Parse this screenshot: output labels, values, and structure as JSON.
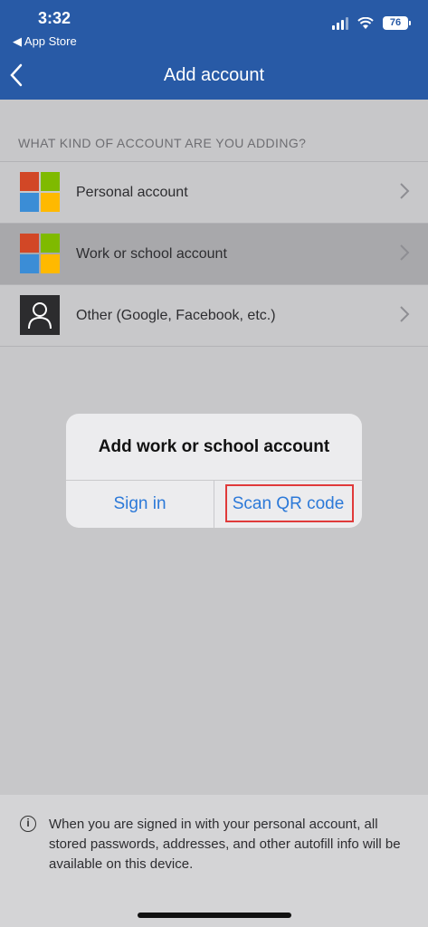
{
  "status_bar": {
    "time": "3:32",
    "back_label": "◀ App Store",
    "battery": "76"
  },
  "nav": {
    "title": "Add account"
  },
  "section": {
    "label": "WHAT KIND OF ACCOUNT ARE YOU ADDING?"
  },
  "accounts": [
    {
      "label": "Personal account"
    },
    {
      "label": "Work or school account"
    },
    {
      "label": "Other (Google, Facebook, etc.)"
    }
  ],
  "dialog": {
    "title": "Add work or school account",
    "sign_in": "Sign in",
    "scan_qr": "Scan QR code"
  },
  "footer": {
    "info_text": "When you are signed in with your personal account, all stored passwords, addresses, and other autofill info will be available on this device."
  },
  "colors": {
    "header": "#285aa6",
    "link": "#2c79d8",
    "highlight": "#e03a3a",
    "ms_red": "#d24726",
    "ms_green": "#7fba00",
    "ms_blue": "#3b8dd6",
    "ms_yellow": "#ffb900"
  }
}
